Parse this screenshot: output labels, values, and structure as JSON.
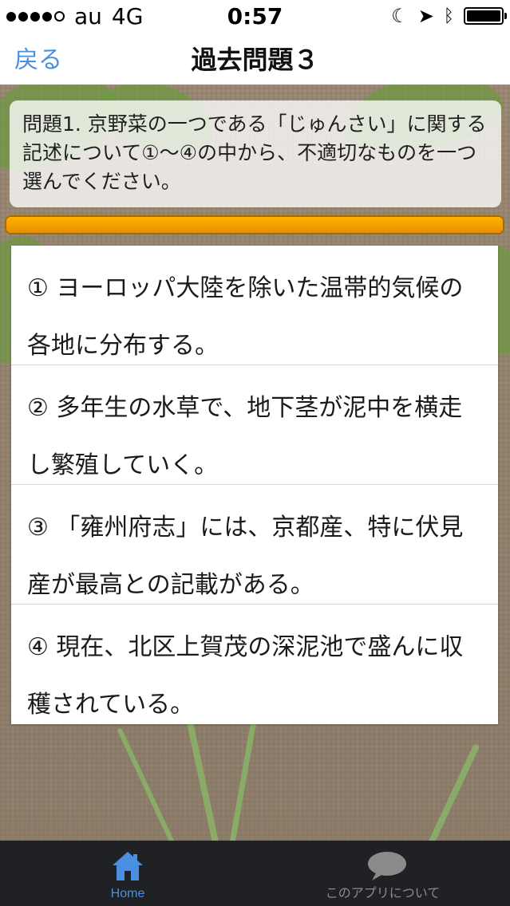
{
  "status_bar": {
    "carrier": "au",
    "network": "4G",
    "time": "0:57",
    "signal_bars": 4,
    "signal_total": 5,
    "icons": [
      "moon-icon",
      "location-icon",
      "bluetooth-icon",
      "battery-icon"
    ]
  },
  "nav": {
    "back_label": "戻る",
    "title": "過去問題３"
  },
  "question": {
    "text": "問題1. 京野菜の一つである「じゅんさい」に関する記述について①～④の中から、不適切なものを一つ選んでください。",
    "progress_fraction": 1.0
  },
  "answers": [
    {
      "text": "① ヨーロッパ大陸を除いた温帯的気候の各地に分布する。"
    },
    {
      "text": "② 多年生の水草で、地下茎が泥中を横走し繁殖していく。"
    },
    {
      "text": "③ 「雍州府志」には、京都産、特に伏見産が最高との記載がある。"
    },
    {
      "text": "④ 現在、北区上賀茂の深泥池で盛んに収穫されている。"
    }
  ],
  "tabbar": {
    "items": [
      {
        "label": "Home",
        "icon": "home-icon",
        "selected": true
      },
      {
        "label": "このアプリについて",
        "icon": "chat-bubble-icon",
        "selected": false
      }
    ]
  },
  "colors": {
    "accent_blue": "#4a90e2",
    "progress_orange": "#f5a000",
    "tabbar_bg": "#1f2124",
    "tab_selected": "#4a90e2",
    "tab_unselected": "#8b8b8b"
  }
}
